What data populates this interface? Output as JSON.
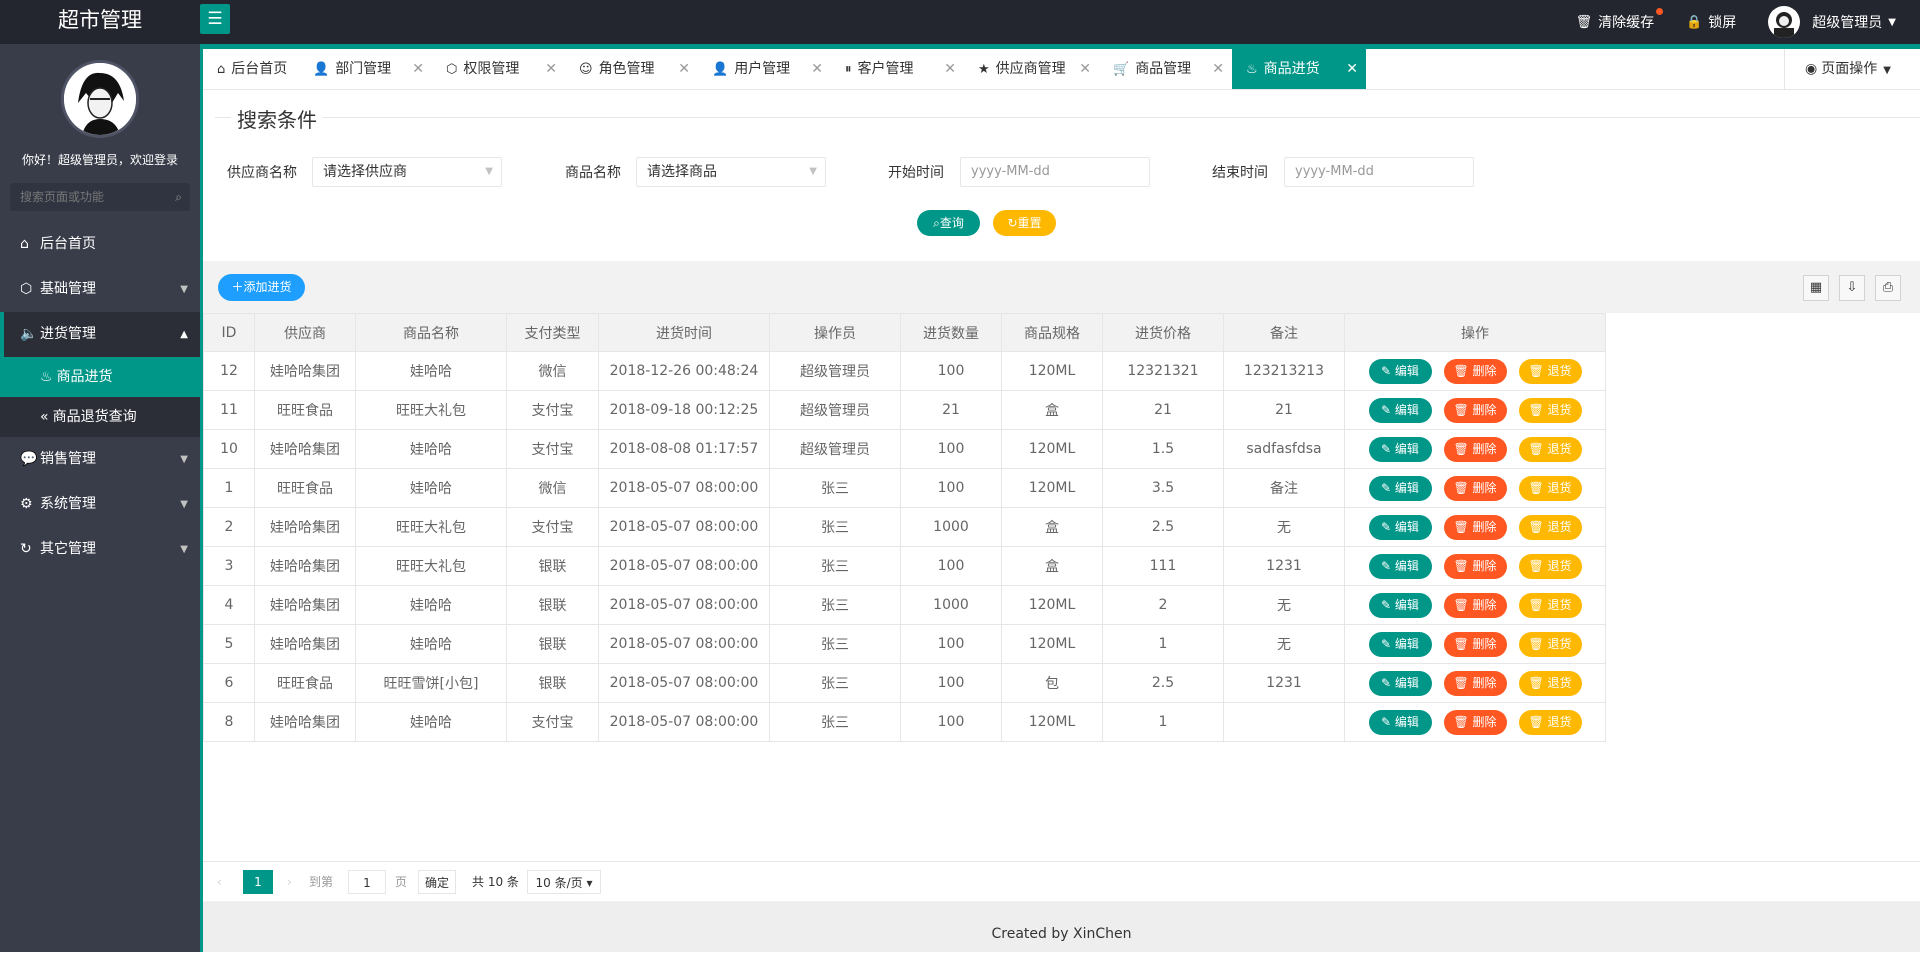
{
  "app": {
    "title": "超市管理"
  },
  "topbar": {
    "clear_cache": "清除缓存",
    "lock_screen": "锁屏",
    "user": "超级管理员"
  },
  "sidebar": {
    "welcome": "你好！超级管理员，欢迎登录",
    "search_placeholder": "搜索页面或功能",
    "items": [
      {
        "label": "后台首页",
        "icon": "home-icon"
      },
      {
        "label": "基础管理",
        "icon": "cube-icon"
      },
      {
        "label": "进货管理",
        "icon": "speaker-icon",
        "sub": [
          {
            "label": "商品进货",
            "icon": "fire-icon"
          },
          {
            "label": "商品退货查询",
            "icon": "double-chevron-left-icon"
          }
        ]
      },
      {
        "label": "销售管理",
        "icon": "chat-icon"
      },
      {
        "label": "系统管理",
        "icon": "gear-icon"
      },
      {
        "label": "其它管理",
        "icon": "refresh-icon"
      }
    ]
  },
  "tabs": [
    {
      "label": "后台首页",
      "icon": "home-icon"
    },
    {
      "label": "部门管理",
      "icon": "user-outline-icon"
    },
    {
      "label": "权限管理",
      "icon": "cube-icon"
    },
    {
      "label": "角色管理",
      "icon": "smile-icon"
    },
    {
      "label": "用户管理",
      "icon": "user-icon"
    },
    {
      "label": "客户管理",
      "icon": "pause-circle-icon"
    },
    {
      "label": "供应商管理",
      "icon": "star-icon"
    },
    {
      "label": "商品管理",
      "icon": "cart-icon"
    },
    {
      "label": "商品进货",
      "icon": "fire-icon",
      "active": true
    }
  ],
  "page_ops": "页面操作",
  "search": {
    "legend": "搜索条件",
    "supplier_label": "供应商名称",
    "supplier_value": "请选择供应商",
    "goods_label": "商品名称",
    "goods_value": "请选择商品",
    "start_label": "开始时间",
    "start_placeholder": "yyyy-MM-dd",
    "end_label": "结束时间",
    "end_placeholder": "yyyy-MM-dd",
    "query": "查询",
    "reset": "重置"
  },
  "toolbar": {
    "add": "添加进货"
  },
  "table": {
    "headers": [
      "ID",
      "供应商",
      "商品名称",
      "支付类型",
      "进货时间",
      "操作员",
      "进货数量",
      "商品规格",
      "进货价格",
      "备注",
      "操作"
    ],
    "ops": {
      "edit": "编辑",
      "delete": "删除",
      "return": "退货"
    },
    "rows": [
      [
        "12",
        "娃哈哈集团",
        "娃哈哈",
        "微信",
        "2018-12-26 00:48:24",
        "超级管理员",
        "100",
        "120ML",
        "12321321",
        "123213213"
      ],
      [
        "11",
        "旺旺食品",
        "旺旺大礼包",
        "支付宝",
        "2018-09-18 00:12:25",
        "超级管理员",
        "21",
        "盒",
        "21",
        "21"
      ],
      [
        "10",
        "娃哈哈集团",
        "娃哈哈",
        "支付宝",
        "2018-08-08 01:17:57",
        "超级管理员",
        "100",
        "120ML",
        "1.5",
        "sadfasfdsa"
      ],
      [
        "1",
        "旺旺食品",
        "娃哈哈",
        "微信",
        "2018-05-07 08:00:00",
        "张三",
        "100",
        "120ML",
        "3.5",
        "备注"
      ],
      [
        "2",
        "娃哈哈集团",
        "旺旺大礼包",
        "支付宝",
        "2018-05-07 08:00:00",
        "张三",
        "1000",
        "盒",
        "2.5",
        "无"
      ],
      [
        "3",
        "娃哈哈集团",
        "旺旺大礼包",
        "银联",
        "2018-05-07 08:00:00",
        "张三",
        "100",
        "盒",
        "111",
        "1231"
      ],
      [
        "4",
        "娃哈哈集团",
        "娃哈哈",
        "银联",
        "2018-05-07 08:00:00",
        "张三",
        "1000",
        "120ML",
        "2",
        "无"
      ],
      [
        "5",
        "娃哈哈集团",
        "娃哈哈",
        "银联",
        "2018-05-07 08:00:00",
        "张三",
        "100",
        "120ML",
        "1",
        "无"
      ],
      [
        "6",
        "旺旺食品",
        "旺旺雪饼[小包]",
        "银联",
        "2018-05-07 08:00:00",
        "张三",
        "100",
        "包",
        "2.5",
        "1231"
      ],
      [
        "8",
        "娃哈哈集团",
        "娃哈哈",
        "支付宝",
        "2018-05-07 08:00:00",
        "张三",
        "100",
        "120ML",
        "1",
        ""
      ]
    ]
  },
  "pager": {
    "current": "1",
    "goto": "到第",
    "page_input": "1",
    "page_unit": "页",
    "confirm": "确定",
    "total": "共 10 条",
    "per_page": "10 条/页"
  },
  "footer": "Created by XinChen"
}
